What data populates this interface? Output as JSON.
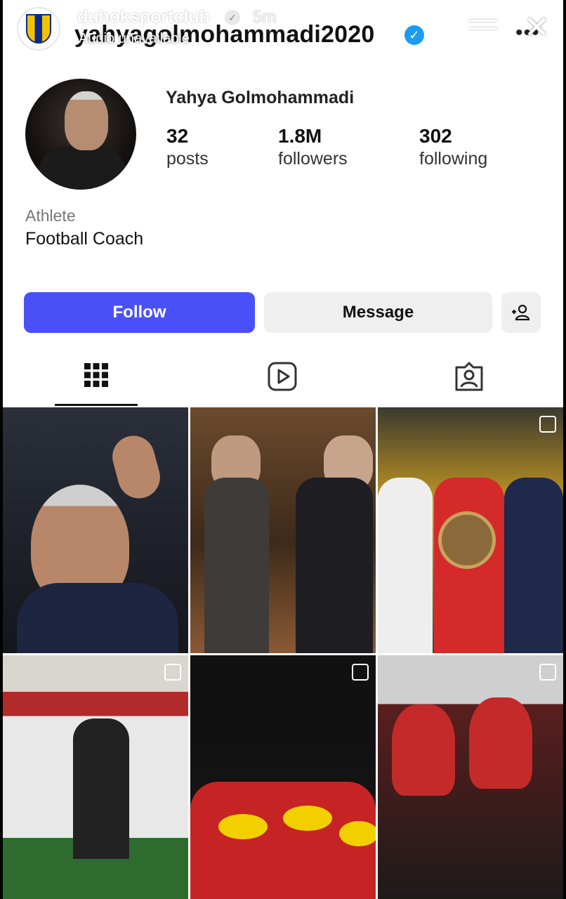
{
  "story": {
    "username": "duhoksportclub",
    "time": "5m",
    "audio_notice": "Audio unavailable"
  },
  "profile": {
    "username": "yahyagolmohammadi2020",
    "full_name": "Yahya Golmohammadi",
    "stats": [
      {
        "value": "32",
        "label": "posts"
      },
      {
        "value": "1.8M",
        "label": "followers"
      },
      {
        "value": "302",
        "label": "following"
      }
    ],
    "category": "Athlete",
    "bio": "Football Coach"
  },
  "actions": {
    "follow": "Follow",
    "message": "Message"
  },
  "icons": {
    "verified": "verified-badge-icon",
    "grid_tab": "grid-icon",
    "reels_tab": "reels-icon",
    "tagged_tab": "tagged-icon",
    "add_person": "add-person-icon",
    "multi_post": "carousel-icon"
  },
  "colors": {
    "follow_button": "#4a50f7",
    "verified": "#1d9bf0",
    "secondary_button": "#efefef"
  }
}
